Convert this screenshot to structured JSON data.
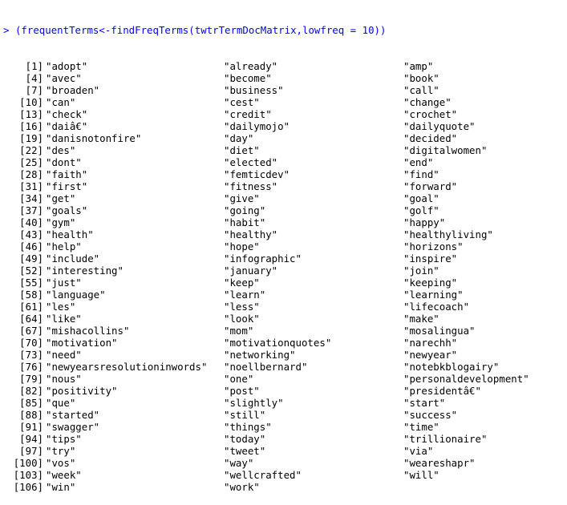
{
  "console": {
    "prompt_symbol": ">",
    "command": "(frequentTerms<-findFreqTerms(twtrTermDocMatrix,lowfreq = 10))",
    "output_rows": [
      {
        "index": "[1]",
        "terms": [
          "\"adopt\"",
          "\"already\"",
          "\"amp\""
        ]
      },
      {
        "index": "[4]",
        "terms": [
          "\"avec\"",
          "\"become\"",
          "\"book\""
        ]
      },
      {
        "index": "[7]",
        "terms": [
          "\"broaden\"",
          "\"business\"",
          "\"call\""
        ]
      },
      {
        "index": "[10]",
        "terms": [
          "\"can\"",
          "\"cest\"",
          "\"change\""
        ]
      },
      {
        "index": "[13]",
        "terms": [
          "\"check\"",
          "\"credit\"",
          "\"crochet\""
        ]
      },
      {
        "index": "[16]",
        "terms": [
          "\"daiâ€\"",
          "\"dailymojo\"",
          "\"dailyquote\""
        ]
      },
      {
        "index": "[19]",
        "terms": [
          "\"danisnotonfire\"",
          "\"day\"",
          "\"decided\""
        ]
      },
      {
        "index": "[22]",
        "terms": [
          "\"des\"",
          "\"diet\"",
          "\"digitalwomen\""
        ]
      },
      {
        "index": "[25]",
        "terms": [
          "\"dont\"",
          "\"elected\"",
          "\"end\""
        ]
      },
      {
        "index": "[28]",
        "terms": [
          "\"faith\"",
          "\"femticdev\"",
          "\"find\""
        ]
      },
      {
        "index": "[31]",
        "terms": [
          "\"first\"",
          "\"fitness\"",
          "\"forward\""
        ]
      },
      {
        "index": "[34]",
        "terms": [
          "\"get\"",
          "\"give\"",
          "\"goal\""
        ]
      },
      {
        "index": "[37]",
        "terms": [
          "\"goals\"",
          "\"going\"",
          "\"golf\""
        ]
      },
      {
        "index": "[40]",
        "terms": [
          "\"gym\"",
          "\"habit\"",
          "\"happy\""
        ]
      },
      {
        "index": "[43]",
        "terms": [
          "\"health\"",
          "\"healthy\"",
          "\"healthyliving\""
        ]
      },
      {
        "index": "[46]",
        "terms": [
          "\"help\"",
          "\"hope\"",
          "\"horizons\""
        ]
      },
      {
        "index": "[49]",
        "terms": [
          "\"include\"",
          "\"infographic\"",
          "\"inspire\""
        ]
      },
      {
        "index": "[52]",
        "terms": [
          "\"interesting\"",
          "\"january\"",
          "\"join\""
        ]
      },
      {
        "index": "[55]",
        "terms": [
          "\"just\"",
          "\"keep\"",
          "\"keeping\""
        ]
      },
      {
        "index": "[58]",
        "terms": [
          "\"language\"",
          "\"learn\"",
          "\"learning\""
        ]
      },
      {
        "index": "[61]",
        "terms": [
          "\"les\"",
          "\"less\"",
          "\"lifecoach\""
        ]
      },
      {
        "index": "[64]",
        "terms": [
          "\"like\"",
          "\"look\"",
          "\"make\""
        ]
      },
      {
        "index": "[67]",
        "terms": [
          "\"mishacollins\"",
          "\"mom\"",
          "\"mosalingua\""
        ]
      },
      {
        "index": "[70]",
        "terms": [
          "\"motivation\"",
          "\"motivationquotes\"",
          "\"narechh\""
        ]
      },
      {
        "index": "[73]",
        "terms": [
          "\"need\"",
          "\"networking\"",
          "\"newyear\""
        ]
      },
      {
        "index": "[76]",
        "terms": [
          "\"newyearsresolutioninwords\"",
          "\"noellbernard\"",
          "\"notebkblogairy\""
        ]
      },
      {
        "index": "[79]",
        "terms": [
          "\"nous\"",
          "\"one\"",
          "\"personaldevelopment\""
        ]
      },
      {
        "index": "[82]",
        "terms": [
          "\"positivity\"",
          "\"post\"",
          "\"presidentâ€\""
        ]
      },
      {
        "index": "[85]",
        "terms": [
          "\"que\"",
          "\"slightly\"",
          "\"start\""
        ]
      },
      {
        "index": "[88]",
        "terms": [
          "\"started\"",
          "\"still\"",
          "\"success\""
        ]
      },
      {
        "index": "[91]",
        "terms": [
          "\"swagger\"",
          "\"things\"",
          "\"time\""
        ]
      },
      {
        "index": "[94]",
        "terms": [
          "\"tips\"",
          "\"today\"",
          "\"trillionaire\""
        ]
      },
      {
        "index": "[97]",
        "terms": [
          "\"try\"",
          "\"tweet\"",
          "\"via\""
        ]
      },
      {
        "index": "[100]",
        "terms": [
          "\"vos\"",
          "\"way\"",
          "\"weareshapr\""
        ]
      },
      {
        "index": "[103]",
        "terms": [
          "\"week\"",
          "\"wellcrafted\"",
          "\"will\""
        ]
      },
      {
        "index": "[106]",
        "terms": [
          "\"win\"",
          "\"work\""
        ]
      }
    ]
  },
  "colors": {
    "prompt": "#0000ff",
    "output": "#000000",
    "background": "#ffffff"
  }
}
